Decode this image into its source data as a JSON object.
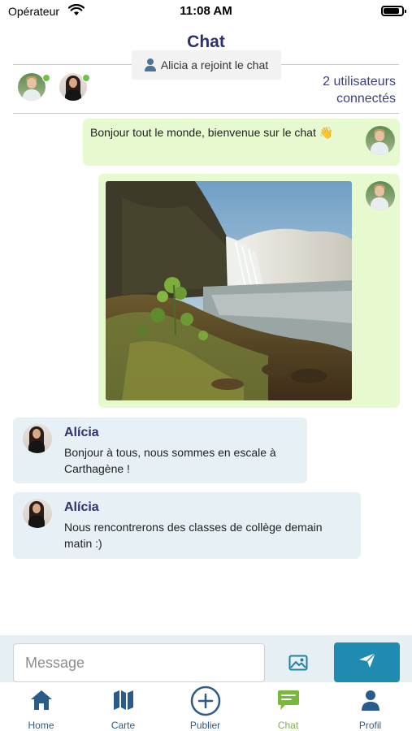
{
  "status_bar": {
    "carrier": "Opérateur",
    "time": "11:08 AM",
    "battery_level": 0.85
  },
  "header": {
    "title": "Chat",
    "join_notice": "Alicia a rejoint le chat",
    "online_count": [
      "2 utilisateurs",
      "connectés"
    ]
  },
  "messages": [
    {
      "type": "outgoing-text",
      "text": "Bonjour tout le monde, bienvenue sur le chat 👋"
    },
    {
      "type": "outgoing-image",
      "image": "waterfall-photo"
    },
    {
      "type": "incoming",
      "sender": "Alícia",
      "text": "Bonjour à tous, nous sommes en escale à Carthagène !"
    },
    {
      "type": "incoming",
      "sender": "Alícia",
      "text": "Nous rencontrerons des classes de collège demain matin :)"
    }
  ],
  "composer": {
    "placeholder": "Message",
    "value": ""
  },
  "tabs": [
    {
      "label": "Home",
      "icon": "home-icon",
      "active": false
    },
    {
      "label": "Carte",
      "icon": "map-icon",
      "active": false
    },
    {
      "label": "Publier",
      "icon": "plus-circle-icon",
      "active": false
    },
    {
      "label": "Chat",
      "icon": "chat-icon",
      "active": true
    },
    {
      "label": "Profil",
      "icon": "user-icon",
      "active": false
    }
  ],
  "colors": {
    "title": "#2c3170",
    "outgoing_bubble": "#e6f9cf",
    "incoming_bubble": "#e7f1f5",
    "send_button": "#1f8bb1",
    "online_dot": "#6cc24a",
    "tab_inactive": "#2a5b8a",
    "tab_active": "#7ab83b"
  }
}
